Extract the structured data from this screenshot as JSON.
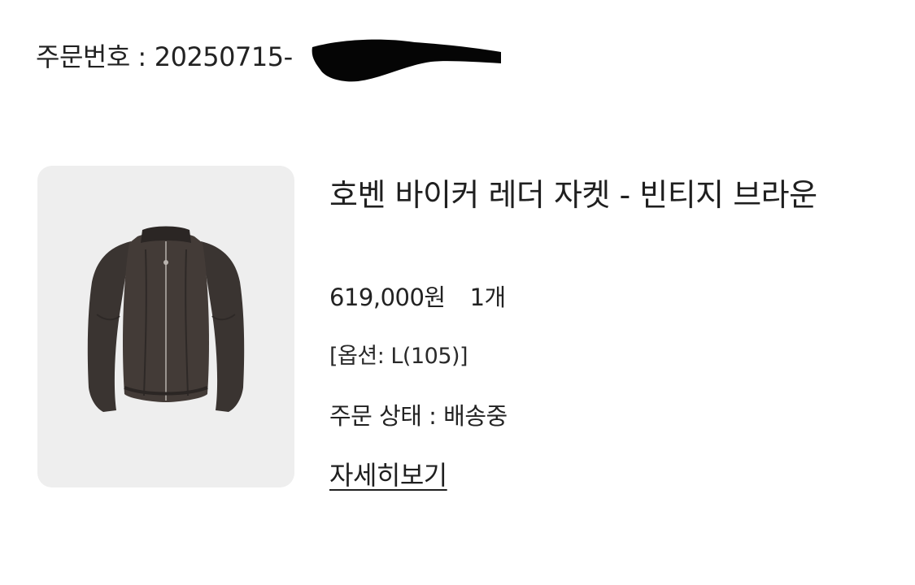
{
  "order": {
    "label": "주문번호 :",
    "number": "20250715-"
  },
  "product": {
    "image_alt": "jacket-image",
    "name": "호벤 바이커 레더 자켓 - 빈티지 브라운",
    "price": "619,000원",
    "quantity": "1개",
    "option": "[옵션: L(105)]",
    "status": "주문 상태 : 배송중",
    "detail_link": "자세히보기"
  },
  "colors": {
    "card_background": "#eeeeee",
    "jacket": "#3a3431",
    "text": "#222222"
  }
}
